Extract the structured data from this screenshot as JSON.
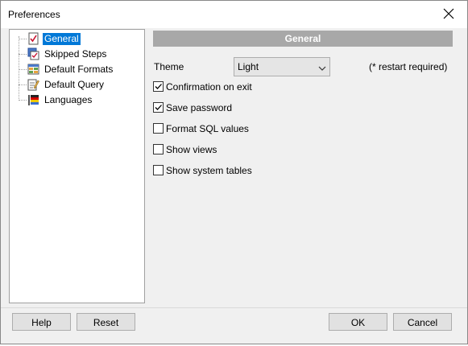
{
  "window": {
    "title": "Preferences"
  },
  "tree": {
    "items": [
      {
        "label": "General",
        "selected": true,
        "icon": "checklist-icon"
      },
      {
        "label": "Skipped Steps",
        "selected": false,
        "icon": "steps-icon"
      },
      {
        "label": "Default Formats",
        "selected": false,
        "icon": "formats-icon"
      },
      {
        "label": "Default Query",
        "selected": false,
        "icon": "query-icon"
      },
      {
        "label": "Languages",
        "selected": false,
        "icon": "flag-icon"
      }
    ]
  },
  "panel": {
    "header": "General",
    "theme": {
      "label": "Theme",
      "value": "Light",
      "note": "(* restart required)"
    },
    "options": [
      {
        "label": "Confirmation on exit",
        "checked": true
      },
      {
        "label": "Save password",
        "checked": true
      },
      {
        "label": "Format SQL values",
        "checked": false
      },
      {
        "label": "Show views",
        "checked": false
      },
      {
        "label": "Show system tables",
        "checked": false
      }
    ]
  },
  "buttons": {
    "help": "Help",
    "reset": "Reset",
    "ok": "OK",
    "cancel": "Cancel"
  }
}
